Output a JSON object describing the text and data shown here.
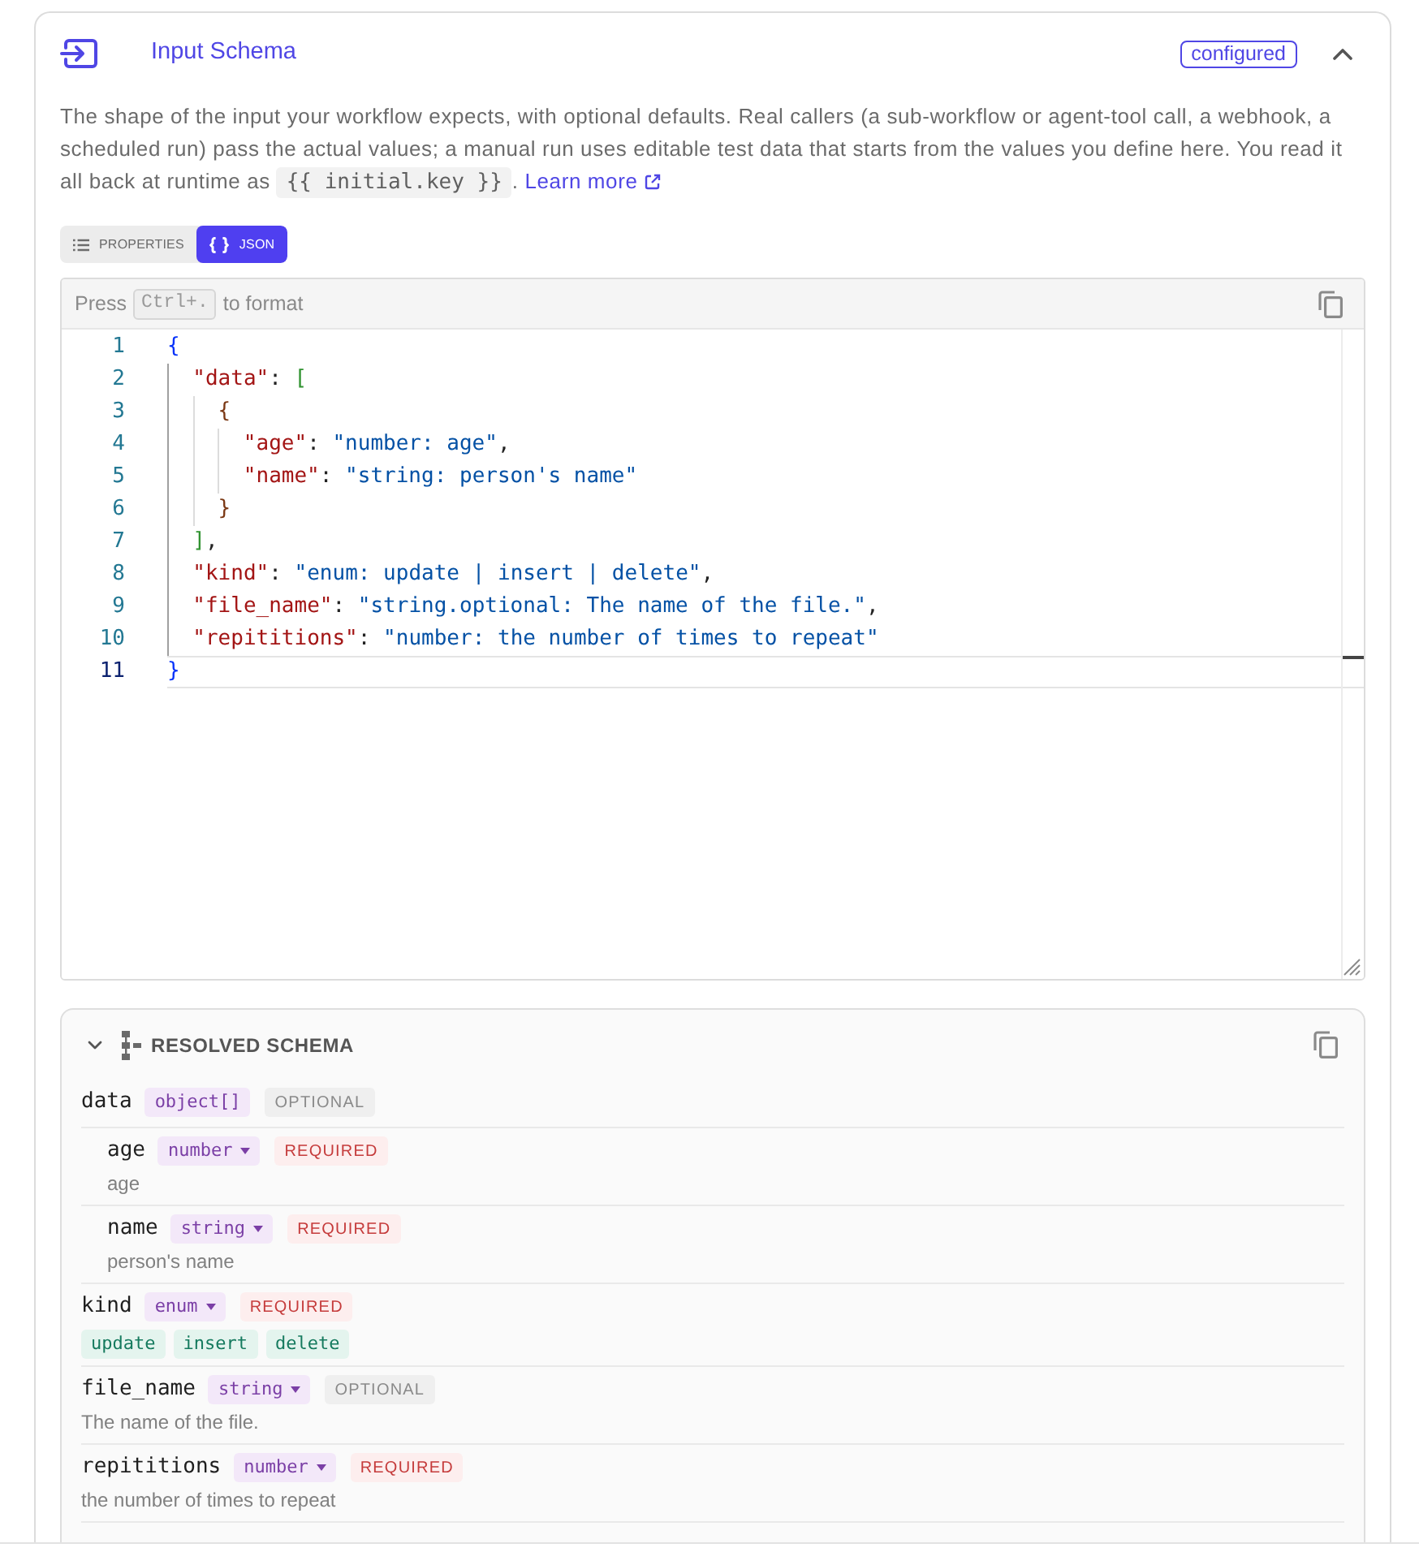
{
  "header": {
    "title": "Input Schema",
    "status": "configured",
    "expanded": true
  },
  "description": {
    "text": "The shape of the input your workflow expects, with optional defaults. Real callers (a sub-workflow or agent-tool call, a webhook, a scheduled run) pass the actual values; a manual run uses editable test data that starts from the values you define here. You read it all back at runtime as",
    "code": "{{ initial.key }}",
    "after_code": ".",
    "link": "Learn more"
  },
  "view_tabs": [
    {
      "label": "PROPERTIES",
      "kind": "form",
      "selected": false
    },
    {
      "label": "JSON",
      "kind": "code",
      "selected": true
    }
  ],
  "editor": {
    "hint_before": "Press",
    "hint_key": "Ctrl+.",
    "hint_after": "to format",
    "lines": [
      {
        "number": "1",
        "text": "{",
        "current": false
      },
      {
        "number": "2",
        "text": "  \"data\": [",
        "current": false
      },
      {
        "number": "3",
        "text": "    {",
        "current": false
      },
      {
        "number": "4",
        "text": "      \"age\": \"number: age\",",
        "current": false
      },
      {
        "number": "5",
        "text": "      \"name\": \"string: person's name\"",
        "current": false
      },
      {
        "number": "6",
        "text": "    }",
        "current": false
      },
      {
        "number": "7",
        "text": "  ],",
        "current": false
      },
      {
        "number": "8",
        "text": "  \"kind\": \"enum: update | insert | delete\",",
        "current": false
      },
      {
        "number": "9",
        "text": "  \"file_name\": \"string.optional: The name of the file.\",",
        "current": false
      },
      {
        "number": "10",
        "text": "  \"repititions\": \"number: the number of times to repeat\"",
        "current": false
      },
      {
        "number": "11",
        "text": "}",
        "current": true
      }
    ]
  },
  "resolved_schema": {
    "title": "RESOLVED SCHEMA",
    "expanded": true,
    "fields": [
      {
        "name": "data",
        "type": "object[]",
        "has_menu": false,
        "requirement": "OPTIONAL",
        "required": false,
        "children": [
          {
            "name": "age",
            "type": "number",
            "has_menu": true,
            "requirement": "REQUIRED",
            "required": true,
            "description": "age"
          },
          {
            "name": "name",
            "type": "string",
            "has_menu": true,
            "requirement": "REQUIRED",
            "required": true,
            "description": "person's name"
          }
        ]
      },
      {
        "name": "kind",
        "type": "enum",
        "has_menu": true,
        "requirement": "REQUIRED",
        "required": true,
        "enum_values": [
          "update",
          "insert",
          "delete"
        ]
      },
      {
        "name": "file_name",
        "type": "string",
        "has_menu": true,
        "requirement": "OPTIONAL",
        "required": false,
        "description": "The name of the file."
      },
      {
        "name": "repititions",
        "type": "number",
        "has_menu": true,
        "requirement": "REQUIRED",
        "required": true,
        "description": "the number of times to repeat"
      }
    ]
  }
}
